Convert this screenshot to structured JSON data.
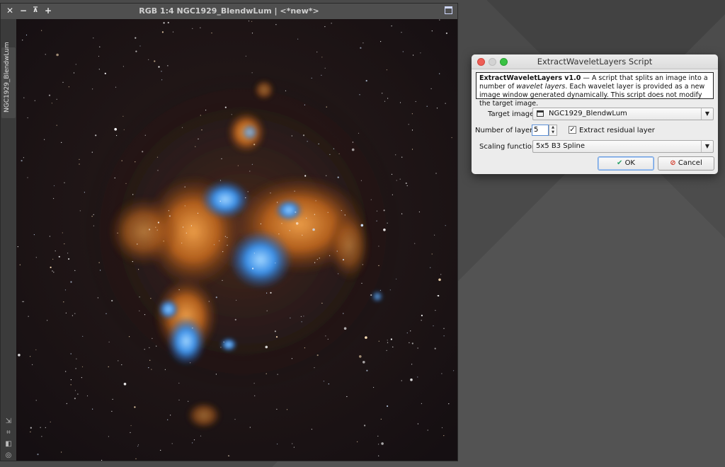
{
  "image_window": {
    "title": "RGB 1:4 NGC1929_BlendwLum | <*new*>",
    "side_tab_label": "NGC1929_BlendwLum",
    "titlebar_icons": [
      "close-icon",
      "minimize-icon",
      "shade-icon",
      "maximize-icon",
      "restore-icon"
    ]
  },
  "dialog": {
    "title": "ExtractWaveletLayers Script",
    "info": {
      "name": "ExtractWaveletLayers v1.0",
      "text_1": " — A script that splits an image into a number of ",
      "italic": "wavelet layers",
      "text_2": ". Each wavelet layer is provided as a new image window generated dynamically. This script does not modify the target image."
    },
    "target_image": {
      "label": "Target image:",
      "value": "NGC1929_BlendwLum"
    },
    "number_of_layers": {
      "label": "Number of layers:",
      "value": "5"
    },
    "extract_residual": {
      "label": "Extract residual layer",
      "checked": true
    },
    "scaling_function": {
      "label": "Scaling function:",
      "value": "5x5 B3 Spline"
    },
    "buttons": {
      "ok": "OK",
      "cancel": "Cancel"
    }
  },
  "colors": {
    "ok_check": "#2fa36b",
    "cancel_icon": "#d23a2a",
    "nebula_blue": "#3a8ee8",
    "nebula_orange": "#d9801f"
  }
}
